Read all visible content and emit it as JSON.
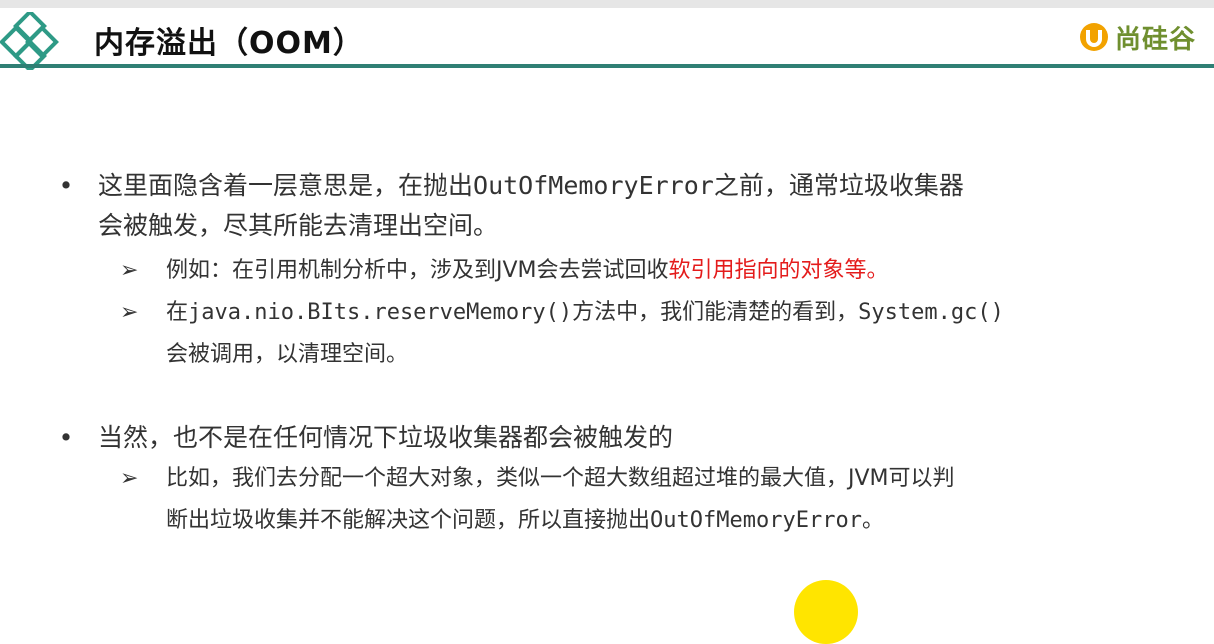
{
  "header": {
    "title": "内存溢出（OOM）",
    "brand_name": "尚硅谷",
    "colors": {
      "rule": "#2f7f74",
      "brand": "#6f8f2f",
      "diamond": "#2e9a86"
    }
  },
  "bullets": [
    {
      "prefix": "这里面隐含着一层意思是，在抛出",
      "code": "OutOfMemoryError",
      "suffix": "之前，通常垃圾收集器",
      "line2": "会被触发，尽其所能去清理出空间。",
      "subs": [
        {
          "text": "例如：在引用机制分析中，涉及到JVM会去尝试回收",
          "highlight": "软引用指向的对象等。"
        },
        {
          "prefix": "在",
          "code": "java.nio.BIts.reserveMemory()",
          "mid": "方法中，我们能清楚的看到，",
          "code2": "System.gc()",
          "line2": "会被调用，以清理空间。"
        }
      ]
    },
    {
      "text": "当然，也不是在任何情况下垃圾收集器都会被触发的",
      "subs": [
        {
          "line1": "比如，我们去分配一个超大对象，类似一个超大数组超过堆的最大值，JVM可以判",
          "prefix": "断出垃圾收集并不能解决这个问题，所以直接抛出",
          "code": "OutOfMemoryError",
          "suffix": "。"
        }
      ]
    }
  ],
  "symbols": {
    "bullet": "•",
    "arrow": "➢"
  },
  "colors": {
    "highlight": "#e41b1b",
    "cursor": "#ffe500"
  }
}
